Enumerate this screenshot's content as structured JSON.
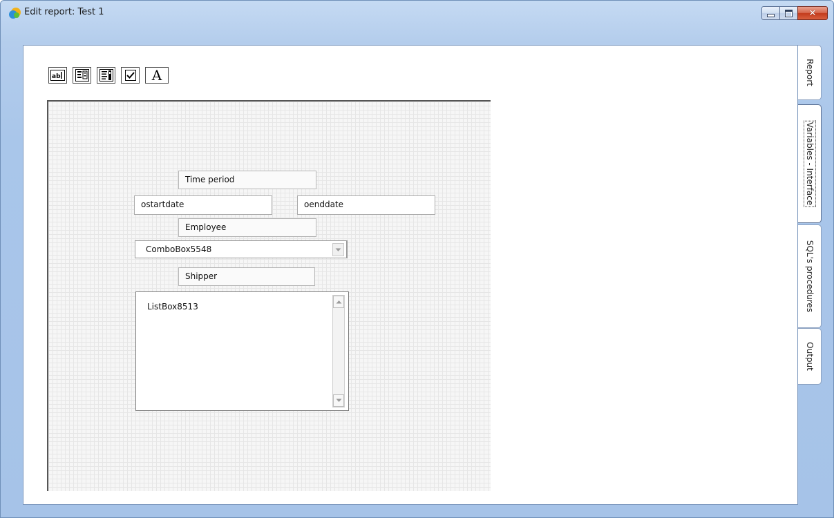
{
  "window": {
    "title": "Edit report: Test 1",
    "controls": {
      "minimize": "minimize-icon",
      "maximize": "maximize-icon",
      "close": "close-icon"
    }
  },
  "toolbar": {
    "items": [
      {
        "name": "textbox-tool",
        "icon": "textbox-icon"
      },
      {
        "name": "combobox-tool",
        "icon": "combobox-icon"
      },
      {
        "name": "listbox-tool",
        "icon": "listbox-icon"
      },
      {
        "name": "checkbox-tool",
        "icon": "checkbox-icon"
      },
      {
        "name": "label-tool",
        "icon": "label-icon",
        "glyph": "A"
      }
    ]
  },
  "form": {
    "time_period_label": "Time period",
    "start_field": "ostartdate",
    "end_field": "oenddate",
    "employee_label": "Employee",
    "employee_combo": "ComboBox5548",
    "shipper_label": "Shipper",
    "shipper_list": "ListBox8513"
  },
  "tabs": [
    {
      "label": "Report",
      "active": false
    },
    {
      "label": "Variables - Interface",
      "active": true
    },
    {
      "label": "SQL's procedures",
      "active": false
    },
    {
      "label": "Output",
      "active": false
    }
  ],
  "colors": {
    "frame_blue": "#a6c3e8",
    "close_red": "#c33b1c"
  }
}
